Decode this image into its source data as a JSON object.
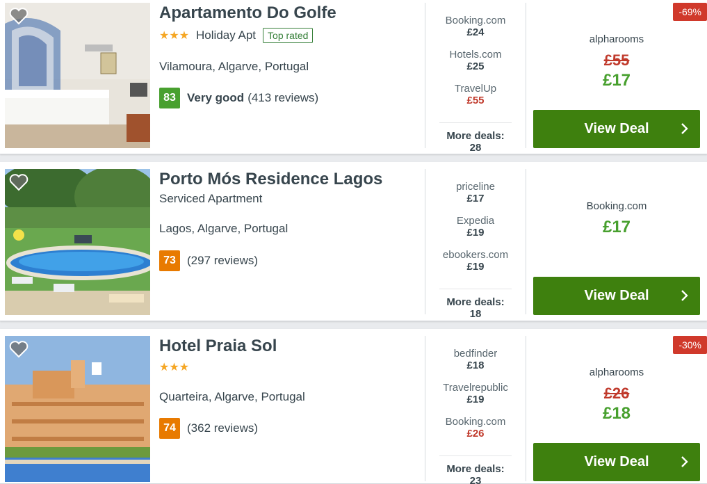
{
  "hotels": [
    {
      "name": "Apartamento Do Golfe",
      "stars": "★★★",
      "type": "Holiday Apt",
      "badge": "Top rated",
      "location": "Vilamoura, Algarve, Portugal",
      "score": "83",
      "score_color": "#48a02f",
      "rating_label": "Very good",
      "reviews": "(413 reviews)",
      "deals": [
        {
          "site": "Booking.com",
          "price": "£24"
        },
        {
          "site": "Hotels.com",
          "price": "£25"
        },
        {
          "site": "TravelUp",
          "price": "£55"
        }
      ],
      "more_deals": "More deals: 28",
      "discount": "-69%",
      "best_provider": "alpharooms",
      "old_price": "£55",
      "price": "£17",
      "cta": "View Deal"
    },
    {
      "name": "Porto Mós Residence Lagos",
      "type": "Serviced Apartment",
      "location": "Lagos, Algarve, Portugal",
      "score": "73",
      "score_color": "#e87a00",
      "reviews": "(297 reviews)",
      "deals": [
        {
          "site": "priceline",
          "price": "£17"
        },
        {
          "site": "Expedia",
          "price": "£19"
        },
        {
          "site": "ebookers.com",
          "price": "£19"
        }
      ],
      "more_deals": "More deals: 18",
      "best_provider": "Booking.com",
      "price": "£17",
      "cta": "View Deal"
    },
    {
      "name": "Hotel Praia Sol",
      "stars": "★★★",
      "location": "Quarteira, Algarve, Portugal",
      "score": "74",
      "score_color": "#e87a00",
      "reviews": "(362 reviews)",
      "deals": [
        {
          "site": "bedfinder",
          "price": "£18"
        },
        {
          "site": "Travelrepublic",
          "price": "£19"
        },
        {
          "site": "Booking.com",
          "price": "£26"
        }
      ],
      "more_deals": "More deals: 23",
      "discount": "-30%",
      "best_provider": "alpharooms",
      "old_price": "£26",
      "price": "£18",
      "cta": "View Deal"
    }
  ],
  "icons": {
    "favorite": "heart-icon",
    "cta_arrow": "chevron-right-icon"
  },
  "colors": {
    "cta_green": "#3e800e",
    "price_green": "#48a02f",
    "discount_red": "#d0392b",
    "star_gold": "#f5a623"
  }
}
